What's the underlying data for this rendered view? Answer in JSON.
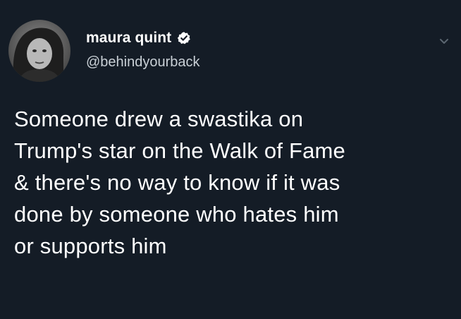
{
  "tweet": {
    "author": {
      "display_name": "maura quint",
      "handle": "@behindyourback",
      "verified": true,
      "avatar_icon": "user-avatar-photo"
    },
    "menu_icon": "chevron-down-icon",
    "text": "Someone drew a swastika on\nTrump's star on the Walk of Fame\n& there's no way to know if it was\ndone by someone who hates him\nor supports him"
  },
  "colors": {
    "background": "#141c26",
    "text": "#ffffff",
    "handle": "#c9d0d6",
    "verified_badge": "#ffffff"
  }
}
